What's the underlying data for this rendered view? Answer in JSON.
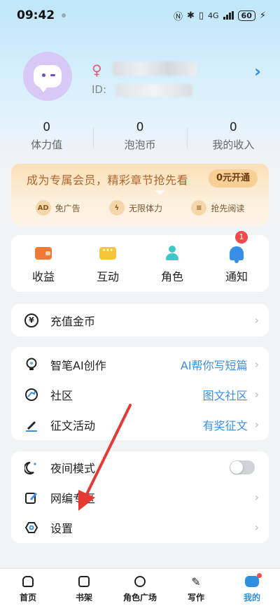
{
  "status_bar": {
    "time": "09:42",
    "network": "4G",
    "battery": "60"
  },
  "profile": {
    "id_label": "ID:"
  },
  "stats": [
    {
      "value": "0",
      "label": "体力值"
    },
    {
      "value": "0",
      "label": "泡泡币"
    },
    {
      "value": "0",
      "label": "我的收入"
    }
  ],
  "vip": {
    "title": "成为专属会员，精彩章节抢先看",
    "button": "0元开通",
    "perks": [
      {
        "icon_text": "AD",
        "label": "免广告"
      },
      {
        "icon_text": "ϟ",
        "label": "无限体力"
      },
      {
        "icon_text": "≡",
        "label": "抢先阅读"
      }
    ]
  },
  "quick_actions": [
    {
      "label": "收益",
      "icon": "wallet-icon"
    },
    {
      "label": "互动",
      "icon": "chat-icon"
    },
    {
      "label": "角色",
      "icon": "person-icon"
    },
    {
      "label": "通知",
      "icon": "bell-icon",
      "badge": "1"
    }
  ],
  "recharge": {
    "label": "充值金币",
    "icon_text": "¥"
  },
  "creation": [
    {
      "label": "智笔AI创作",
      "value": "AI帮你写短篇",
      "icon": "lightbulb-icon"
    },
    {
      "label": "社区",
      "value": "图文社区",
      "icon": "community-icon"
    },
    {
      "label": "征文活动",
      "value": "有奖征文",
      "icon": "pen-icon"
    }
  ],
  "settings": [
    {
      "label": "夜间模式",
      "icon": "moon-icon"
    },
    {
      "label": "网编专区",
      "icon": "edit-icon"
    },
    {
      "label": "设置",
      "icon": "settings-icon"
    }
  ],
  "tabs": [
    {
      "label": "首页",
      "icon": "home-icon"
    },
    {
      "label": "书架",
      "icon": "bookshelf-icon"
    },
    {
      "label": "角色广场",
      "icon": "planet-icon"
    },
    {
      "label": "写作",
      "icon": "write-icon"
    },
    {
      "label": "我的",
      "icon": "me-icon",
      "active": true
    }
  ],
  "colors": {
    "accent": "#2c8fe0",
    "vip_text": "#b1652d",
    "badge": "#f04b4b",
    "annotation": "#e53935"
  }
}
